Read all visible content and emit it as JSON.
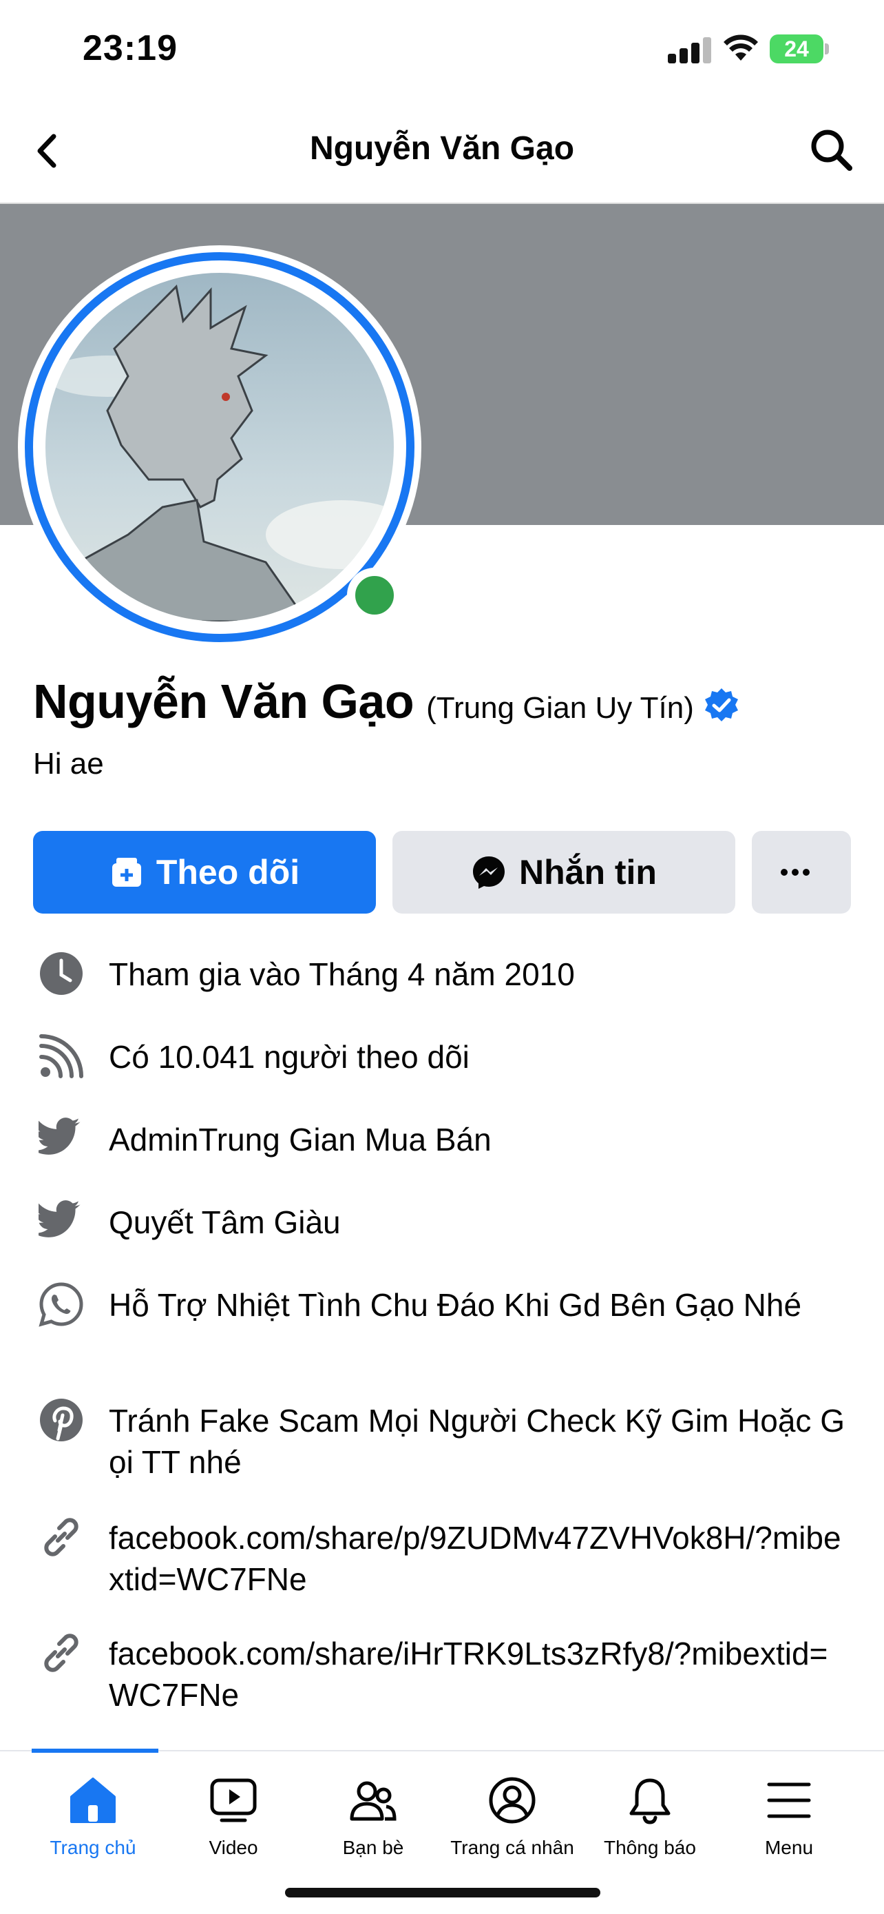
{
  "status_bar": {
    "time": "23:19",
    "battery": "24"
  },
  "header": {
    "title": "Nguyễn Văn Gạo"
  },
  "profile": {
    "name": "Nguyễn Văn Gạo",
    "alias": "(Trung Gian Uy Tín)",
    "bio": "Hi ae",
    "verified": true,
    "online": true
  },
  "actions": {
    "follow_label": "Theo dõi",
    "message_label": "Nhắn tin",
    "more_label": "···"
  },
  "intro": [
    {
      "icon": "clock-icon",
      "text": "Tham gia vào Tháng 4 năm 2010"
    },
    {
      "icon": "rss-icon",
      "text": "Có 10.041 người theo dõi"
    },
    {
      "icon": "twitter-icon",
      "text": "AdminTrung Gian Mua Bán"
    },
    {
      "icon": "twitter-icon",
      "text": "Quyết Tâm Giàu"
    },
    {
      "icon": "whatsapp-icon",
      "text": "Hỗ Trợ Nhiệt Tình Chu Đáo Khi Gd Bên Gạo Nhé"
    },
    {
      "icon": "pinterest-icon",
      "text": "Tránh Fake Scam Mọi Người Check Kỹ Gim Hoặc Gọi TT nhé"
    },
    {
      "icon": "link-icon",
      "text": "facebook.com/share/p/9ZUDMv47ZVHVok8H/?mibextid=WC7FNe"
    },
    {
      "icon": "link-icon",
      "text": "facebook.com/share/iHrTRK9Lts3zRfy8/?mibextid=WC7FNe"
    }
  ],
  "bottom_nav": [
    {
      "label": "Trang chủ",
      "icon": "home-icon",
      "active": true
    },
    {
      "label": "Video",
      "icon": "video-icon",
      "active": false
    },
    {
      "label": "Bạn bè",
      "icon": "friends-icon",
      "active": false
    },
    {
      "label": "Trang cá nhân",
      "icon": "profile-icon",
      "active": false
    },
    {
      "label": "Thông báo",
      "icon": "bell-icon",
      "active": false
    },
    {
      "label": "Menu",
      "icon": "menu-icon",
      "active": false
    }
  ],
  "colors": {
    "accent": "#1877f2",
    "online": "#31a24c",
    "cover": "#898d91",
    "button_gray": "#e4e6eb"
  }
}
